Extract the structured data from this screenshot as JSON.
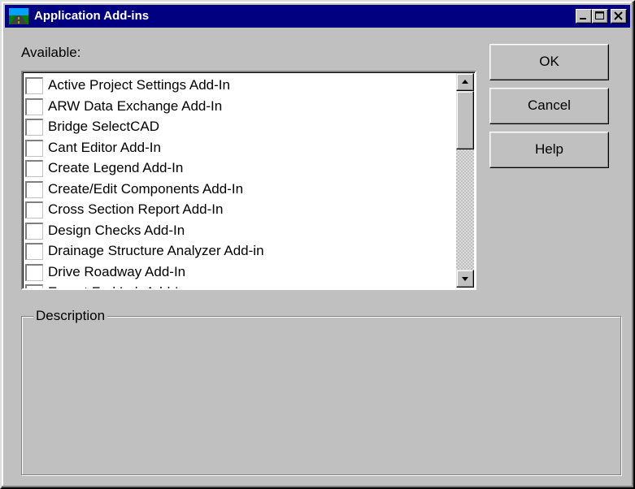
{
  "window": {
    "title": "Application Add-ins"
  },
  "available": {
    "label": "Available:",
    "items": [
      {
        "label": "Active Project Settings Add-In",
        "checked": false
      },
      {
        "label": "ARW Data Exchange Add-In",
        "checked": false
      },
      {
        "label": "Bridge SelectCAD",
        "checked": false
      },
      {
        "label": "Cant Editor Add-In",
        "checked": false
      },
      {
        "label": "Create Legend Add-In",
        "checked": false
      },
      {
        "label": "Create/Edit Components Add-In",
        "checked": false
      },
      {
        "label": "Cross Section Report Add-In",
        "checked": false
      },
      {
        "label": "Design Checks Add-In",
        "checked": false
      },
      {
        "label": "Drainage Structure Analyzer Add-in",
        "checked": false
      },
      {
        "label": "Drive Roadway Add-In",
        "checked": false
      },
      {
        "label": "Export Fed Lab Add-In",
        "checked": false
      }
    ]
  },
  "buttons": {
    "ok": "OK",
    "cancel": "Cancel",
    "help": "Help"
  },
  "description": {
    "label": "Description"
  },
  "colors": {
    "titlebar": "#000080",
    "face": "#c0c0c0"
  },
  "icons": {
    "title": "road-app-icon",
    "minimize": "minimize-icon",
    "maximize": "maximize-icon",
    "close": "close-icon",
    "scroll_up": "arrow-up-icon",
    "scroll_down": "arrow-down-icon"
  }
}
